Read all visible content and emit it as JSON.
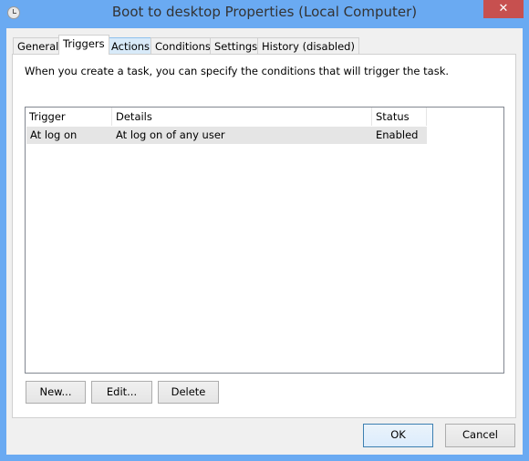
{
  "window": {
    "title": "Boot to desktop Properties (Local Computer)",
    "close_glyph": "✕",
    "icon": "clock-icon"
  },
  "tabs": [
    {
      "label": "General"
    },
    {
      "label": "Triggers",
      "active": true
    },
    {
      "label": "Actions",
      "hover": true
    },
    {
      "label": "Conditions"
    },
    {
      "label": "Settings"
    },
    {
      "label": "History (disabled)"
    }
  ],
  "triggers": {
    "description": "When you create a task, you can specify the conditions that will trigger the task.",
    "columns": [
      "Trigger",
      "Details",
      "Status"
    ],
    "rows": [
      {
        "trigger": "At log on",
        "details": "At log on of any user",
        "status": "Enabled"
      }
    ],
    "buttons": {
      "new": "New...",
      "edit": "Edit...",
      "delete": "Delete"
    }
  },
  "footer": {
    "ok": "OK",
    "cancel": "Cancel"
  }
}
